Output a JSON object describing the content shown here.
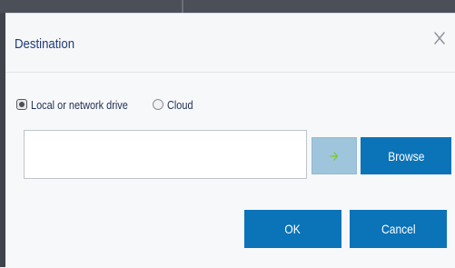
{
  "dialog": {
    "title": "Destination",
    "close_icon": "close-icon"
  },
  "source": {
    "options": [
      {
        "label": "Local or network drive",
        "selected": true
      },
      {
        "label": "Cloud",
        "selected": false
      }
    ]
  },
  "path_field": {
    "value": "",
    "placeholder": ""
  },
  "buttons": {
    "go_icon": "arrow-right-icon",
    "browse": "Browse",
    "ok": "OK",
    "cancel": "Cancel"
  },
  "colors": {
    "title": "#1e3a78",
    "primary_button": "#0b73b7",
    "disabled_go_button": "#9ec5db",
    "go_arrow": "#7ac943"
  }
}
